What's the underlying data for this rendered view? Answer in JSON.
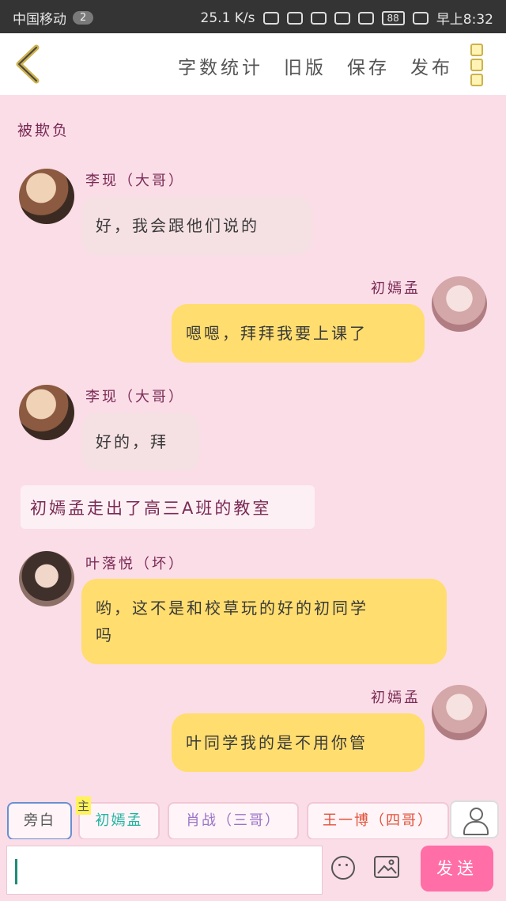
{
  "status_bar": {
    "carrier": "中国移动",
    "notif_count": "2",
    "speed": "25.1 K/s",
    "battery": "88",
    "time": "早上8:32"
  },
  "toolbar": {
    "word_count": "字数统计",
    "old_version": "旧版",
    "save": "保存",
    "publish": "发布"
  },
  "chat": {
    "title": "被欺负",
    "messages": [
      {
        "speaker": "李现（大哥）",
        "text": "好，我会跟他们说的"
      },
      {
        "speaker": "初嫣孟",
        "text": "嗯嗯，拜拜我要上课了"
      },
      {
        "speaker": "李现（大哥）",
        "text": "好的，拜"
      },
      {
        "narration": "初嫣孟走出了高三A班的教室"
      },
      {
        "speaker": "叶落悦（坏）",
        "text_line1": "哟，这不是和校草玩的好的初同学",
        "text_line2": "吗"
      },
      {
        "speaker": "初嫣孟",
        "text": "叶同学我的是不用你管"
      }
    ]
  },
  "roles": {
    "narrator": "旁白",
    "main_tag": "主",
    "main": "初嫣孟",
    "xiaozhan": "肖战（三哥）",
    "wangyibo": "王一博（四哥）"
  },
  "input": {
    "send": "发送"
  },
  "colors": {
    "background": "#fbdde7",
    "bubble_yellow": "#ffdd6e",
    "bubble_pink": "#f5e0e3",
    "send_button": "#ff6ea7",
    "name_color": "#7a2a55"
  }
}
